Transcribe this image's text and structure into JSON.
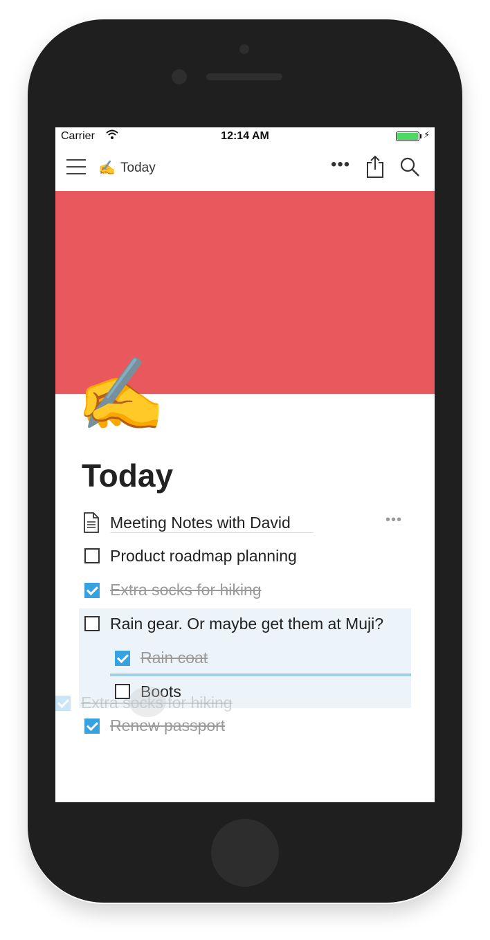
{
  "status_bar": {
    "carrier": "Carrier",
    "time": "12:14 AM",
    "battery_level": 1.0
  },
  "nav": {
    "page_emoji": "✍️",
    "title": "Today",
    "more_icon": "•••"
  },
  "page": {
    "cover_color": "#e8585d",
    "icon": "✍️",
    "title": "Today"
  },
  "blocks": {
    "page_link": {
      "label": "Meeting Notes with David",
      "more": "•••"
    },
    "todo_1": {
      "label": "Product roadmap planning",
      "checked": false
    },
    "todo_2": {
      "label": "Extra socks for hiking",
      "checked": true
    },
    "todo_3": {
      "label": "Rain gear. Or maybe get them at Muji?",
      "checked": false
    },
    "todo_3a": {
      "label": "Rain coat",
      "checked": true
    },
    "todo_3b": {
      "label": "Boots",
      "checked": false
    },
    "dragging": {
      "label": "Extra socks for hiking",
      "checked": true
    },
    "todo_4": {
      "label": "Renew passport",
      "checked": true
    }
  },
  "colors": {
    "accent": "#36a2e0",
    "cover": "#e8585d",
    "battery": "#4cd964"
  }
}
